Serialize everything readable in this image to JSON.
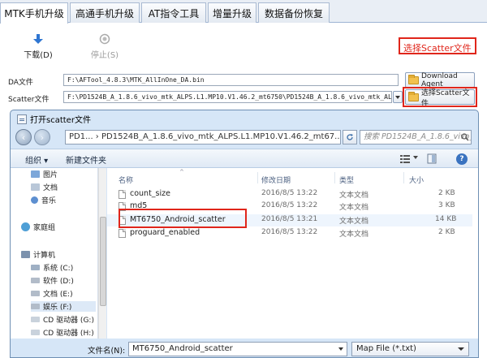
{
  "tabs": [
    {
      "label": "MTK手机升级",
      "active": true
    },
    {
      "label": "高通手机升级",
      "active": false
    },
    {
      "label": "AT指令工具",
      "active": false
    },
    {
      "label": "增量升级",
      "active": false
    },
    {
      "label": "数据备份恢复",
      "active": false
    }
  ],
  "toolbar": {
    "download_label": "下载(D)",
    "stop_label": "停止(S)"
  },
  "fields": {
    "da_label": "DA文件",
    "da_value": "F:\\AFTool_4.8.3\\MTK_AllInOne_DA.bin",
    "da_button": "Download Agent",
    "scatter_label": "Scatter文件",
    "scatter_value": "F:\\PD1524B_A_1.8.6_vivo_mtk_ALPS.L1.MP10.V1.46.2_mt6750\\PD1524B_A_1.8.6_vivo_mtk_ALPS.L",
    "scatter_button": "选择Scatter文件"
  },
  "callout": {
    "text": "选择Scatter文件",
    "color": "#e0261b"
  },
  "dialog": {
    "title": "打开scatter文件",
    "address": "PD1... › PD1524B_A_1.8.6_vivo_mtk_ALPS.L1.MP10.V1.46.2_mt67...",
    "search_placeholder": "搜索 PD1524B_A_1.8.6_vivo_...",
    "organize": "组织 ▾",
    "new_folder": "新建文件夹",
    "nav": [
      {
        "label": "图片",
        "group": false,
        "color": "#7da7d9"
      },
      {
        "label": "文档",
        "group": false,
        "color": "#b9c7d8"
      },
      {
        "label": "音乐",
        "group": false,
        "color": "#5d8fd0"
      },
      {
        "label": "家庭组",
        "group": true,
        "color": "#4f9fd6"
      },
      {
        "label": "计算机",
        "group": true,
        "color": "#7c92ad"
      },
      {
        "label": "系统 (C:)",
        "group": false,
        "color": "#9fb0c4"
      },
      {
        "label": "软件 (D:)",
        "group": false,
        "color": "#b2bcc9"
      },
      {
        "label": "文档 (E:)",
        "group": false,
        "color": "#b2bcc9"
      },
      {
        "label": "娱乐 (F:)",
        "group": false,
        "color": "#b2bcc9"
      },
      {
        "label": "CD 驱动器 (G:)",
        "group": false,
        "color": "#c9d2dc"
      },
      {
        "label": "CD 驱动器 (H:)",
        "group": false,
        "color": "#c9d2dc"
      }
    ],
    "columns": {
      "name": "名称",
      "modified": "修改日期",
      "type": "类型",
      "size": "大小"
    },
    "files": [
      {
        "name": "count_size",
        "modified": "2016/8/5 13:22",
        "type": "文本文档",
        "size": "2 KB"
      },
      {
        "name": "md5",
        "modified": "2016/8/5 13:22",
        "type": "文本文档",
        "size": "3 KB"
      },
      {
        "name": "MT6750_Android_scatter",
        "modified": "2016/8/5 13:21",
        "type": "文本文档",
        "size": "14 KB"
      },
      {
        "name": "proguard_enabled",
        "modified": "2016/8/5 13:22",
        "type": "文本文档",
        "size": "2 KB"
      }
    ],
    "filename_label": "文件名(N):",
    "filename_value": "MT6750_Android_scatter",
    "filetype_value": "Map File (*.txt)"
  }
}
